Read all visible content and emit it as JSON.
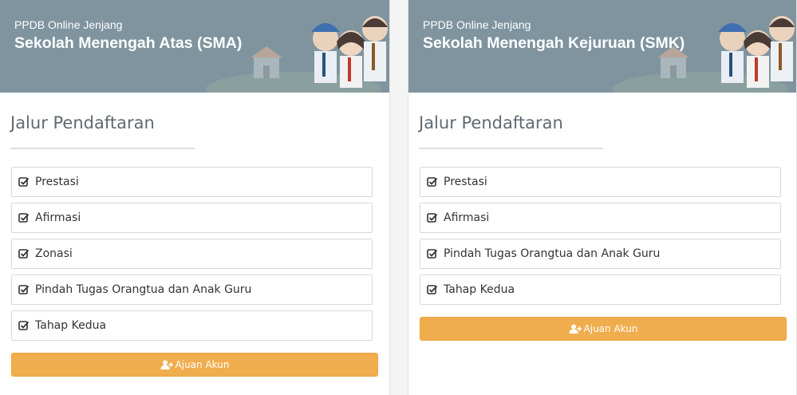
{
  "panels": [
    {
      "subtitle": "PPDB Online Jenjang",
      "title": "Sekolah Menengah Atas (SMA)",
      "section_title": "Jalur Pendaftaran",
      "items": [
        "Prestasi",
        "Afirmasi",
        "Zonasi",
        "Pindah Tugas Orangtua dan Anak Guru",
        "Tahap Kedua"
      ],
      "button_label": "Ajuan Akun"
    },
    {
      "subtitle": "PPDB Online Jenjang",
      "title": "Sekolah Menengah Kejuruan (SMK)",
      "section_title": "Jalur Pendaftaran",
      "items": [
        "Prestasi",
        "Afirmasi",
        "Pindah Tugas Orangtua dan Anak Guru",
        "Tahap Kedua"
      ],
      "button_label": "Ajuan Akun"
    }
  ],
  "colors": {
    "banner": "#7f949f",
    "button": "#f0ad4e"
  },
  "icons": {
    "item": "check-square-icon",
    "button": "user-plus-icon",
    "banner": "students-illustration"
  }
}
